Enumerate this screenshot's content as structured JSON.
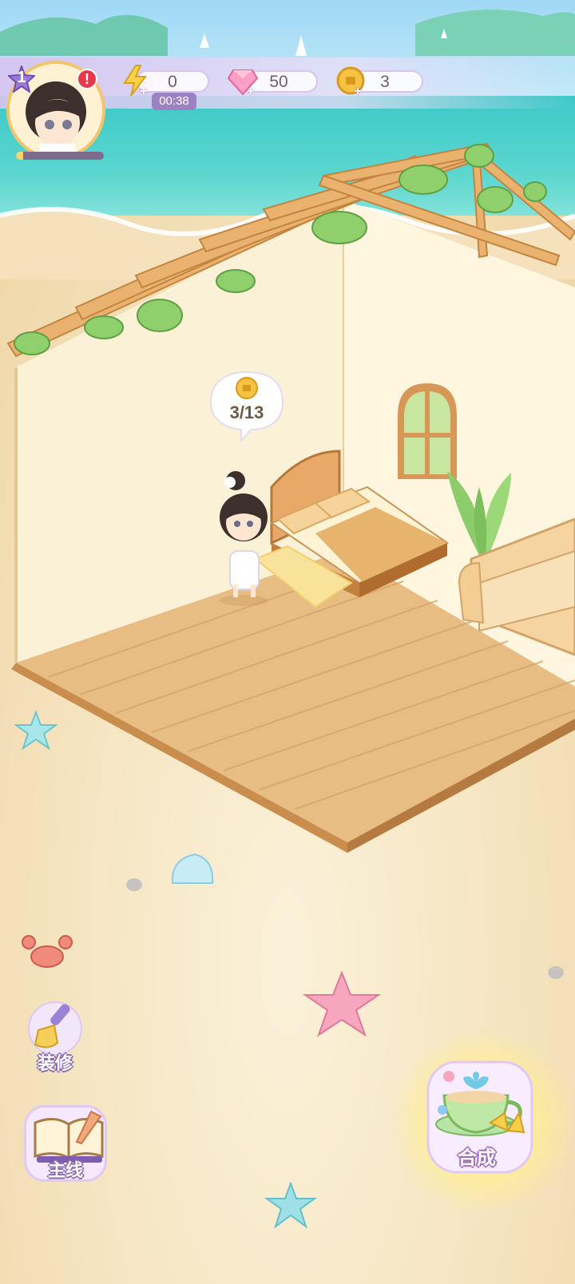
{
  "player": {
    "level": "1",
    "alert": "!"
  },
  "resources": {
    "energy": {
      "value": "0",
      "timer": "00:38",
      "icon": "lightning-icon"
    },
    "gems": {
      "value": "50",
      "icon": "gem-icon"
    },
    "coins": {
      "value": "3",
      "icon": "coin-icon"
    }
  },
  "room": {
    "coin_progress": "3/13"
  },
  "buttons": {
    "decorate": {
      "label": "装修",
      "icon": "brush-icon"
    },
    "main_quest": {
      "label": "主线",
      "icon": "book-icon"
    },
    "merge": {
      "label": "合成",
      "icon": "teacup-icon"
    }
  },
  "colors": {
    "accent": "#b693e0",
    "gold": "#f5c242",
    "gem": "#ff9fc8"
  }
}
